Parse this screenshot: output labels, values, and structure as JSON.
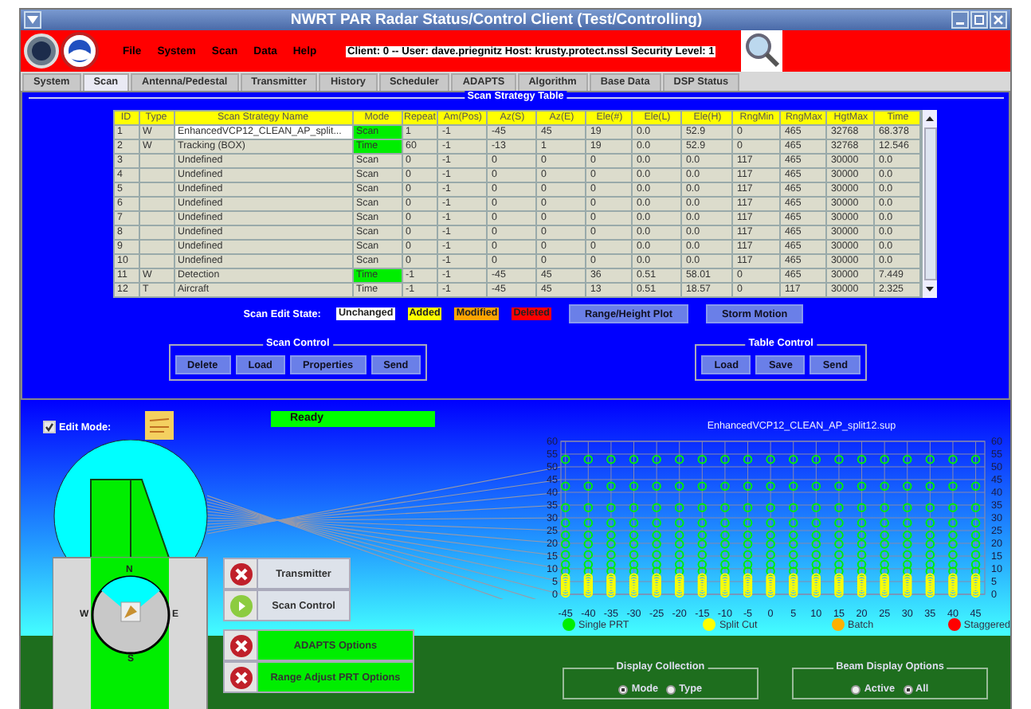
{
  "window": {
    "title": "NWRT PAR Radar Status/Control Client (Test/Controlling)"
  },
  "menu": [
    "File",
    "System",
    "Scan",
    "Data",
    "Help"
  ],
  "client_info": "Client: 0 -- User: dave.priegnitz   Host: krusty.protect.nssl  Security Level: 1",
  "tabs": [
    {
      "label": "System",
      "selected": false
    },
    {
      "label": "Scan",
      "selected": true
    },
    {
      "label": "Antenna/Pedestal",
      "selected": false
    },
    {
      "label": "Transmitter",
      "selected": false
    },
    {
      "label": "History",
      "selected": false
    },
    {
      "label": "Scheduler",
      "selected": false
    },
    {
      "label": "ADAPTS",
      "selected": false
    },
    {
      "label": "Algorithm",
      "selected": false
    },
    {
      "label": "Base Data",
      "selected": false
    },
    {
      "label": "DSP Status",
      "selected": false
    }
  ],
  "table": {
    "title": "Scan Strategy Table",
    "columns": [
      "ID",
      "Type",
      "Scan Strategy Name",
      "Mode",
      "Repeat",
      "Am(Pos)",
      "Az(S)",
      "Az(E)",
      "Ele(#)",
      "Ele(L)",
      "Ele(H)",
      "RngMin",
      "RngMax",
      "HgtMax",
      "Time"
    ],
    "rows": [
      {
        "selected": true,
        "mode_active": true,
        "cells": [
          "1",
          "W",
          "EnhancedVCP12_CLEAN_AP_split...",
          "Scan",
          "1",
          "-1",
          "-45",
          "45",
          "19",
          "0.0",
          "52.9",
          "0",
          "465",
          "32768",
          "68.378"
        ]
      },
      {
        "selected": false,
        "mode_active": true,
        "cells": [
          "2",
          "W",
          "Tracking (BOX)",
          "Time",
          "60",
          "-1",
          "-13",
          "1",
          "19",
          "0.0",
          "52.9",
          "0",
          "465",
          "32768",
          "12.546"
        ]
      },
      {
        "selected": false,
        "mode_active": false,
        "cells": [
          "3",
          "",
          "Undefined",
          "Scan",
          "0",
          "-1",
          "0",
          "0",
          "0",
          "0.0",
          "0.0",
          "117",
          "465",
          "30000",
          "0.0"
        ]
      },
      {
        "selected": false,
        "mode_active": false,
        "cells": [
          "4",
          "",
          "Undefined",
          "Scan",
          "0",
          "-1",
          "0",
          "0",
          "0",
          "0.0",
          "0.0",
          "117",
          "465",
          "30000",
          "0.0"
        ]
      },
      {
        "selected": false,
        "mode_active": false,
        "cells": [
          "5",
          "",
          "Undefined",
          "Scan",
          "0",
          "-1",
          "0",
          "0",
          "0",
          "0.0",
          "0.0",
          "117",
          "465",
          "30000",
          "0.0"
        ]
      },
      {
        "selected": false,
        "mode_active": false,
        "cells": [
          "6",
          "",
          "Undefined",
          "Scan",
          "0",
          "-1",
          "0",
          "0",
          "0",
          "0.0",
          "0.0",
          "117",
          "465",
          "30000",
          "0.0"
        ]
      },
      {
        "selected": false,
        "mode_active": false,
        "cells": [
          "7",
          "",
          "Undefined",
          "Scan",
          "0",
          "-1",
          "0",
          "0",
          "0",
          "0.0",
          "0.0",
          "117",
          "465",
          "30000",
          "0.0"
        ]
      },
      {
        "selected": false,
        "mode_active": false,
        "cells": [
          "8",
          "",
          "Undefined",
          "Scan",
          "0",
          "-1",
          "0",
          "0",
          "0",
          "0.0",
          "0.0",
          "117",
          "465",
          "30000",
          "0.0"
        ]
      },
      {
        "selected": false,
        "mode_active": false,
        "cells": [
          "9",
          "",
          "Undefined",
          "Scan",
          "0",
          "-1",
          "0",
          "0",
          "0",
          "0.0",
          "0.0",
          "117",
          "465",
          "30000",
          "0.0"
        ]
      },
      {
        "selected": false,
        "mode_active": false,
        "cells": [
          "10",
          "",
          "Undefined",
          "Scan",
          "0",
          "-1",
          "0",
          "0",
          "0",
          "0.0",
          "0.0",
          "117",
          "465",
          "30000",
          "0.0"
        ]
      },
      {
        "selected": false,
        "mode_active": true,
        "cells": [
          "11",
          "W",
          "Detection",
          "Time",
          "-1",
          "-1",
          "-45",
          "45",
          "36",
          "0.51",
          "58.01",
          "0",
          "465",
          "30000",
          "7.449"
        ]
      },
      {
        "selected": false,
        "mode_active": false,
        "cells": [
          "12",
          "T",
          "Aircraft",
          "Time",
          "-1",
          "-1",
          "-45",
          "45",
          "13",
          "0.51",
          "18.57",
          "0",
          "117",
          "30000",
          "2.325"
        ]
      }
    ]
  },
  "edit_state": {
    "label": "Scan Edit State:",
    "states": [
      {
        "label": "Unchanged",
        "color": "#ffffff"
      },
      {
        "label": "Added",
        "color": "#ffff00"
      },
      {
        "label": "Modified",
        "color": "#ffa500"
      },
      {
        "label": "Deleted",
        "color": "#ff0000"
      }
    ],
    "buttons": [
      "Range/Height Plot",
      "Storm Motion"
    ]
  },
  "control_groups": [
    {
      "title": "Scan Control",
      "buttons": [
        "Delete",
        "Load",
        "Properties",
        "Send"
      ]
    },
    {
      "title": "Table Control",
      "buttons": [
        "Load",
        "Save",
        "Send"
      ]
    }
  ],
  "scene": {
    "edit_mode": {
      "label": "Edit Mode:",
      "checked": true
    },
    "status": "Ready",
    "compass": [
      "N",
      "E",
      "S",
      "W"
    ],
    "actions": [
      {
        "label": "Transmitter",
        "kind": "stop",
        "highlighted": false
      },
      {
        "label": "Scan Control",
        "kind": "play",
        "highlighted": false
      },
      {
        "label": "ADAPTS Options",
        "kind": "stop",
        "highlighted": true
      },
      {
        "label": "Range Adjust PRT Options",
        "kind": "stop",
        "highlighted": true
      }
    ],
    "plot": {
      "chart_data": {
        "type": "scatter",
        "title": "EnhancedVCP12_CLEAN_AP_split12.sup",
        "grid": true,
        "series": [
          {
            "name": "Single PRT",
            "color": "#00ee00",
            "x": [
              -45,
              -40,
              -35,
              -30,
              -25,
              -20,
              -15,
              -10,
              -5,
              0,
              5,
              10,
              15,
              20,
              25,
              30,
              35,
              40,
              45,
              -45,
              -40,
              -35,
              -30,
              -25,
              -20,
              -15,
              -10,
              -5,
              0,
              5,
              10,
              15,
              20,
              25,
              30,
              35,
              40,
              45,
              -45,
              -40,
              -35,
              -30,
              -25,
              -20,
              -15,
              -10,
              -5,
              0,
              5,
              10,
              15,
              20,
              25,
              30,
              35,
              40,
              45,
              -45,
              -40,
              -35,
              -30,
              -25,
              -20,
              -15,
              -10,
              -5,
              0,
              5,
              10,
              15,
              20,
              25,
              30,
              35,
              40,
              45,
              -45,
              -40,
              -35,
              -30,
              -25,
              -20,
              -15,
              -10,
              -5,
              0,
              5,
              10,
              15,
              20,
              25,
              30,
              35,
              40,
              45,
              -45,
              -40,
              -35,
              -30,
              -25,
              -20,
              -15,
              -10,
              -5,
              0,
              5,
              10,
              15,
              20,
              25,
              30,
              35,
              40,
              45,
              -45,
              -40,
              -35,
              -30,
              -25,
              -20,
              -15,
              -10,
              -5,
              0,
              5,
              10,
              15,
              20,
              25,
              30,
              35,
              40,
              45,
              -45,
              -40,
              -35,
              -30,
              -25,
              -20,
              -15,
              -10,
              -5,
              0,
              5,
              10,
              15,
              20,
              25,
              30,
              35,
              40,
              45,
              -45,
              -40,
              -35,
              -30,
              -25,
              -20,
              -15,
              -10,
              -5,
              0,
              5,
              10,
              15,
              20,
              25,
              30,
              35,
              40,
              45
            ],
            "values": [
              52.9,
              52.9,
              52.9,
              52.9,
              52.9,
              52.9,
              52.9,
              52.9,
              52.9,
              52.9,
              52.9,
              52.9,
              52.9,
              52.9,
              52.9,
              52.9,
              52.9,
              52.9,
              52.9,
              42.4,
              42.4,
              42.4,
              42.4,
              42.4,
              42.4,
              42.4,
              42.4,
              42.4,
              42.4,
              42.4,
              42.4,
              42.4,
              42.4,
              42.4,
              42.4,
              42.4,
              42.4,
              42.4,
              34,
              34,
              34,
              34,
              34,
              34,
              34,
              34,
              34,
              34,
              34,
              34,
              34,
              34,
              34,
              34,
              34,
              34,
              34,
              28,
              28,
              28,
              28,
              28,
              28,
              28,
              28,
              28,
              28,
              28,
              28,
              28,
              28,
              28,
              28,
              28,
              28,
              28,
              23.2,
              23.2,
              23.2,
              23.2,
              23.2,
              23.2,
              23.2,
              23.2,
              23.2,
              23.2,
              23.2,
              23.2,
              23.2,
              23.2,
              23.2,
              23.2,
              23.2,
              23.2,
              23.2,
              19.7,
              19.7,
              19.7,
              19.7,
              19.7,
              19.7,
              19.7,
              19.7,
              19.7,
              19.7,
              19.7,
              19.7,
              19.7,
              19.7,
              19.7,
              19.7,
              19.7,
              19.7,
              19.7,
              15.5,
              15.5,
              15.5,
              15.5,
              15.5,
              15.5,
              15.5,
              15.5,
              15.5,
              15.5,
              15.5,
              15.5,
              15.5,
              15.5,
              15.5,
              15.5,
              15.5,
              15.5,
              15.5,
              11.7,
              11.7,
              11.7,
              11.7,
              11.7,
              11.7,
              11.7,
              11.7,
              11.7,
              11.7,
              11.7,
              11.7,
              11.7,
              11.7,
              11.7,
              11.7,
              11.7,
              11.7,
              11.7,
              9,
              9,
              9,
              9,
              9,
              9,
              9,
              9,
              9,
              9,
              9,
              9,
              9,
              9,
              9,
              9,
              9,
              9,
              9
            ]
          },
          {
            "name": "Split Cut",
            "color": "#ffff00",
            "x": [
              -45,
              -40,
              -35,
              -30,
              -25,
              -20,
              -15,
              -10,
              -5,
              0,
              5,
              10,
              15,
              20,
              25,
              30,
              35,
              40,
              45,
              -45,
              -40,
              -35,
              -30,
              -25,
              -20,
              -15,
              -10,
              -5,
              0,
              5,
              10,
              15,
              20,
              25,
              30,
              35,
              40,
              45,
              -45,
              -40,
              -35,
              -30,
              -25,
              -20,
              -15,
              -10,
              -5,
              0,
              5,
              10,
              15,
              20,
              25,
              30,
              35,
              40,
              45,
              -45,
              -40,
              -35,
              -30,
              -25,
              -20,
              -15,
              -10,
              -5,
              0,
              5,
              10,
              15,
              20,
              25,
              30,
              35,
              40,
              45,
              -45,
              -40,
              -35,
              -30,
              -25,
              -20,
              -15,
              -10,
              -5,
              0,
              5,
              10,
              15,
              20,
              25,
              30,
              35,
              40,
              45,
              -45,
              -40,
              -35,
              -30,
              -25,
              -20,
              -15,
              -10,
              -5,
              0,
              5,
              10,
              15,
              20,
              25,
              30,
              35,
              40,
              45,
              -45,
              -40,
              -35,
              -30,
              -25,
              -20,
              -15,
              -10,
              -5,
              0,
              5,
              10,
              15,
              20,
              25,
              30,
              35,
              40,
              45
            ],
            "values": [
              0.5,
              0.5,
              0.5,
              0.5,
              0.5,
              0.5,
              0.5,
              0.5,
              0.5,
              0.5,
              0.5,
              0.5,
              0.5,
              0.5,
              0.5,
              0.5,
              0.5,
              0.5,
              0.5,
              1.5,
              1.5,
              1.5,
              1.5,
              1.5,
              1.5,
              1.5,
              1.5,
              1.5,
              1.5,
              1.5,
              1.5,
              1.5,
              1.5,
              1.5,
              1.5,
              1.5,
              1.5,
              1.5,
              2.5,
              2.5,
              2.5,
              2.5,
              2.5,
              2.5,
              2.5,
              2.5,
              2.5,
              2.5,
              2.5,
              2.5,
              2.5,
              2.5,
              2.5,
              2.5,
              2.5,
              2.5,
              2.5,
              3.5,
              3.5,
              3.5,
              3.5,
              3.5,
              3.5,
              3.5,
              3.5,
              3.5,
              3.5,
              3.5,
              3.5,
              3.5,
              3.5,
              3.5,
              3.5,
              3.5,
              3.5,
              3.5,
              4.5,
              4.5,
              4.5,
              4.5,
              4.5,
              4.5,
              4.5,
              4.5,
              4.5,
              4.5,
              4.5,
              4.5,
              4.5,
              4.5,
              4.5,
              4.5,
              4.5,
              4.5,
              4.5,
              5.5,
              5.5,
              5.5,
              5.5,
              5.5,
              5.5,
              5.5,
              5.5,
              5.5,
              5.5,
              5.5,
              5.5,
              5.5,
              5.5,
              5.5,
              5.5,
              5.5,
              5.5,
              5.5,
              6.5,
              6.5,
              6.5,
              6.5,
              6.5,
              6.5,
              6.5,
              6.5,
              6.5,
              6.5,
              6.5,
              6.5,
              6.5,
              6.5,
              6.5,
              6.5,
              6.5,
              6.5,
              6.5
            ]
          },
          {
            "name": "Batch",
            "color": "#ffb000"
          },
          {
            "name": "Staggered",
            "color": "#ff0000"
          }
        ],
        "xlim": [
          -46,
          47
        ],
        "ylim": [
          0,
          60
        ],
        "xticks": [
          -45,
          -40,
          -35,
          -30,
          -25,
          -20,
          -15,
          -10,
          -5,
          0,
          5,
          10,
          15,
          20,
          25,
          30,
          35,
          40,
          45
        ],
        "yticks": [
          0,
          5,
          10,
          15,
          20,
          25,
          30,
          35,
          40,
          45,
          50,
          55,
          60
        ]
      },
      "right_axis_labels": [
        "60",
        "55",
        "50",
        "45",
        "40",
        "35",
        "30",
        "25",
        "20",
        "15",
        "10",
        "5",
        "0"
      ]
    },
    "radio_groups": [
      {
        "title": "Display Collection",
        "options": [
          {
            "label": "Mode",
            "selected": true
          },
          {
            "label": "Type",
            "selected": false
          }
        ]
      },
      {
        "title": "Beam Display Options",
        "options": [
          {
            "label": "Active",
            "selected": false
          },
          {
            "label": "All",
            "selected": true
          }
        ]
      }
    ]
  }
}
